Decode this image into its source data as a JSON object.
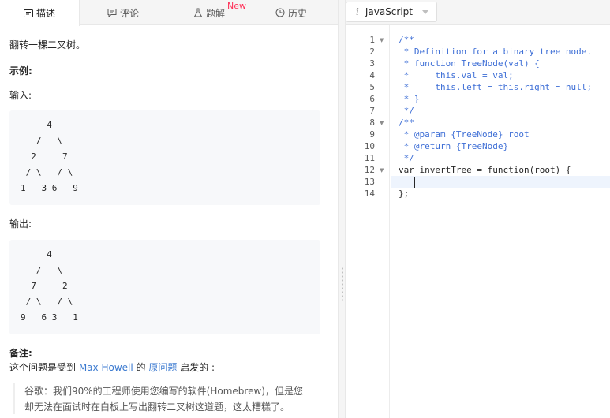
{
  "tabs": [
    {
      "label": "描述",
      "icon": "description-icon"
    },
    {
      "label": "评论",
      "icon": "comment-icon"
    },
    {
      "label": "题解",
      "icon": "solution-flask-icon",
      "badge": "New"
    },
    {
      "label": "历史",
      "icon": "history-clock-icon"
    }
  ],
  "problem": {
    "intro": "翻转一棵二叉树。",
    "example_heading": "示例:",
    "input_label": "输入:",
    "input_tree": [
      "     4",
      "   /   \\",
      "  2     7",
      " / \\   / \\",
      "1   3 6   9"
    ],
    "output_label": "输出:",
    "output_tree": [
      "     4",
      "   /   \\",
      "  7     2",
      " / \\   / \\",
      "9   6 3   1"
    ],
    "note_heading": "备注:",
    "note_text_1": "这个问题是受到 ",
    "note_link_1": "Max Howell",
    "note_text_2": " 的 ",
    "note_link_2": "原问题",
    "note_text_3": " 启发的 :",
    "quote_line_1": "谷歌：我们90%的工程师使用您编写的软件(Homebrew)，但是您",
    "quote_line_2": "却无法在面试时在白板上写出翻转二叉树这道题，这太糟糕了。"
  },
  "editor": {
    "language": "JavaScript",
    "line_numbers": [
      "1",
      "2",
      "3",
      "4",
      "5",
      "6",
      "7",
      "8",
      "9",
      "10",
      "11",
      "12",
      "13",
      "14"
    ],
    "lines": [
      "/**",
      " * Definition for a binary tree node.",
      " * function TreeNode(val) {",
      " *     this.val = val;",
      " *     this.left = this.right = null;",
      " * }",
      " */",
      "/**",
      " * @param {TreeNode} root",
      " * @return {TreeNode}",
      " */",
      "var invertTree = function(root) {",
      "",
      "};"
    ],
    "active_line": 13
  }
}
